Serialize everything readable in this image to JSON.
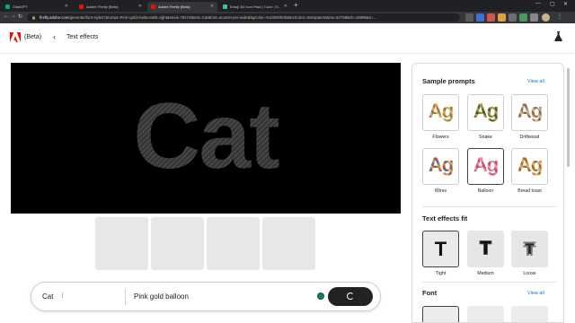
{
  "browser": {
    "tabs": [
      {
        "label": "ChatGPT",
        "fav_color": "#10a37f"
      },
      {
        "label": "Adobe Firefly (Beta)",
        "fav_color": "#eb1000"
      },
      {
        "label": "Adobe Firefly (Beta)",
        "fav_color": "#eb1000"
      },
      {
        "label": "Emoji 3D Icon Pack | Color | S...",
        "fav_color": "#3ec1a0"
      }
    ],
    "new_tab": "+",
    "url_host": "firefly.adobe.com",
    "url_path": "/generate/font-styles?prompt=Pink+gold+balloon&fit=tight&seed=78174&text=Cat&font=acumin-pro-wide&bgColor=%23000000&textColor=transparent&cw=32768&ch=16896&ir=..."
  },
  "app": {
    "beta_label": "(Beta)",
    "page_title": "Text effects"
  },
  "canvas": {
    "text": "Cat"
  },
  "prompt_bar": {
    "subject": "Cat",
    "prompt": "Pink gold balloon"
  },
  "panel": {
    "sample_prompts": {
      "title": "Sample prompts",
      "view_all": "View all",
      "items": [
        {
          "label": "Flowers",
          "glyph": "Ag",
          "colors": [
            "#d24a4a",
            "#e8c24a",
            "#6aa84f"
          ]
        },
        {
          "label": "Snake",
          "glyph": "Ag",
          "colors": [
            "#6b7b3a",
            "#c9a646",
            "#3c4a24"
          ]
        },
        {
          "label": "Driftwood",
          "glyph": "Ag",
          "colors": [
            "#b08a62",
            "#7b5a3c",
            "#d8c2a4"
          ]
        },
        {
          "label": "Wires",
          "glyph": "Ag",
          "colors": [
            "#3a6ea5",
            "#c94f3b",
            "#e2b340"
          ]
        },
        {
          "label": "Balloon",
          "glyph": "Ag",
          "colors": [
            "#e0607e",
            "#f2a5b8",
            "#c03b5c"
          ]
        },
        {
          "label": "Bread toast",
          "glyph": "Ag",
          "colors": [
            "#c88a3d",
            "#8a5a22",
            "#e8c07a"
          ]
        }
      ],
      "selected_index": 4
    },
    "fit": {
      "title": "Text effects fit",
      "items": [
        {
          "label": "Tight",
          "glyph": "T"
        },
        {
          "label": "Medium",
          "glyph": "T"
        },
        {
          "label": "Loose",
          "glyph": "T"
        }
      ],
      "selected_index": 0
    },
    "font": {
      "title": "Font",
      "view_all": "View all"
    }
  }
}
